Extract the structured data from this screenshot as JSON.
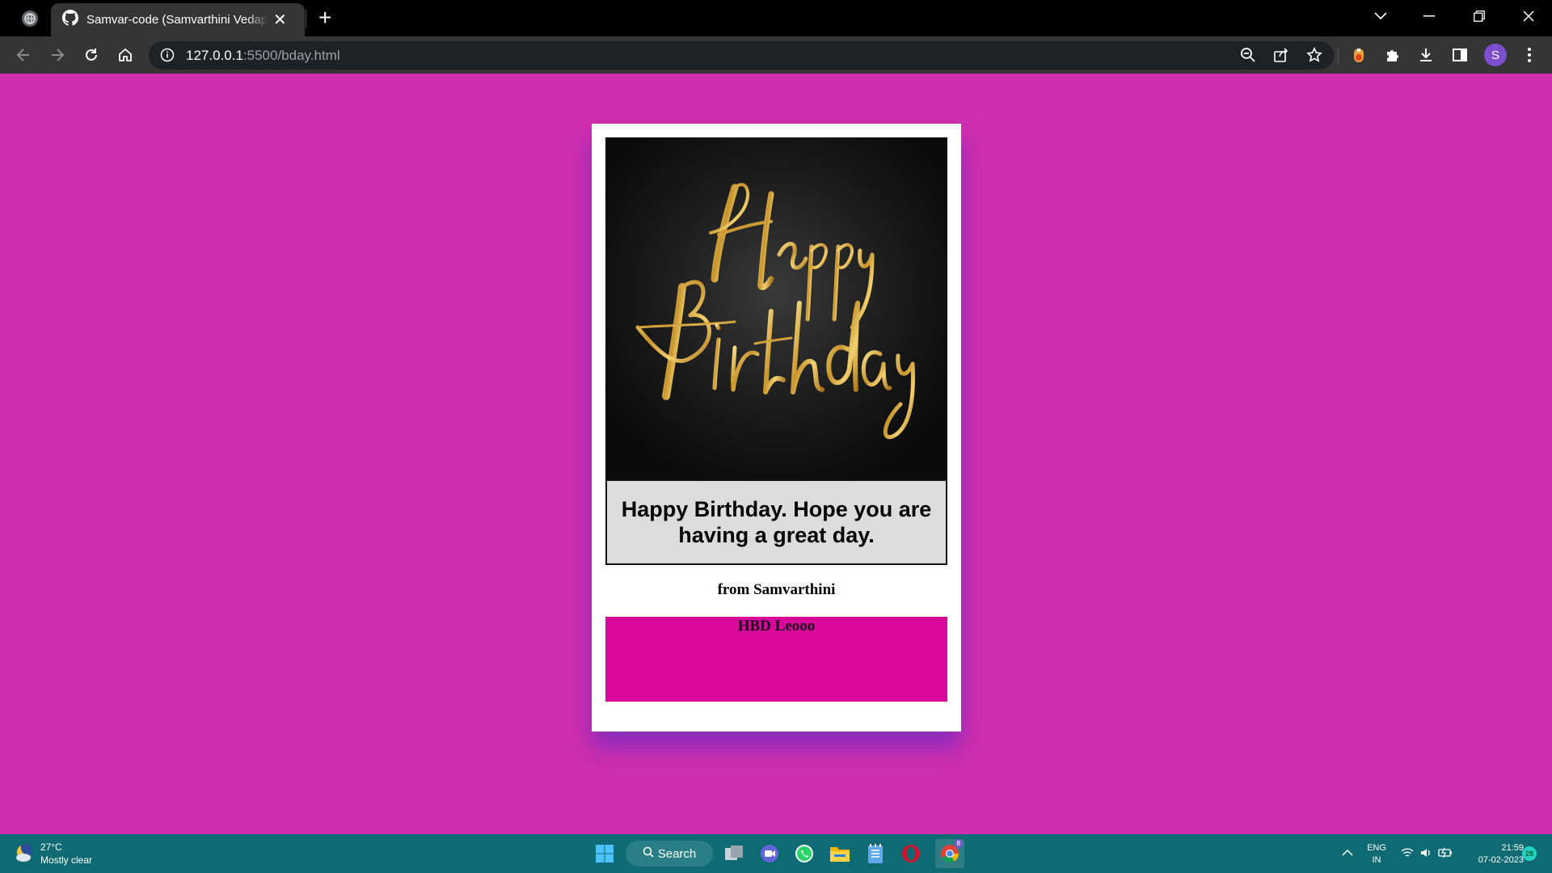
{
  "browser": {
    "tab_title": "Samvar-code (Samvarthini Vedapuri)",
    "close_glyph": "✕",
    "new_tab_glyph": "+",
    "url_host": "127.0.0.1",
    "url_path": ":5500/bday.html",
    "profile_initial": "S",
    "profile_color": "#7d4fd0"
  },
  "page": {
    "background_color": "#d02eae",
    "image_alt_text": "Happy Birthday",
    "message": "Happy Birthday. Hope you are having a great day.",
    "from_text": "from Samvarthini",
    "hbd_text": "HBD Leooo",
    "hbd_box_color": "#d9079a"
  },
  "taskbar": {
    "weather_temp": "27°C",
    "weather_desc": "Mostly clear",
    "search_label": "Search",
    "lang_line1": "ENG",
    "lang_line2": "IN",
    "time": "21:59",
    "date": "07-02-2023",
    "notification_count": "28",
    "chrome_badge": "8"
  }
}
